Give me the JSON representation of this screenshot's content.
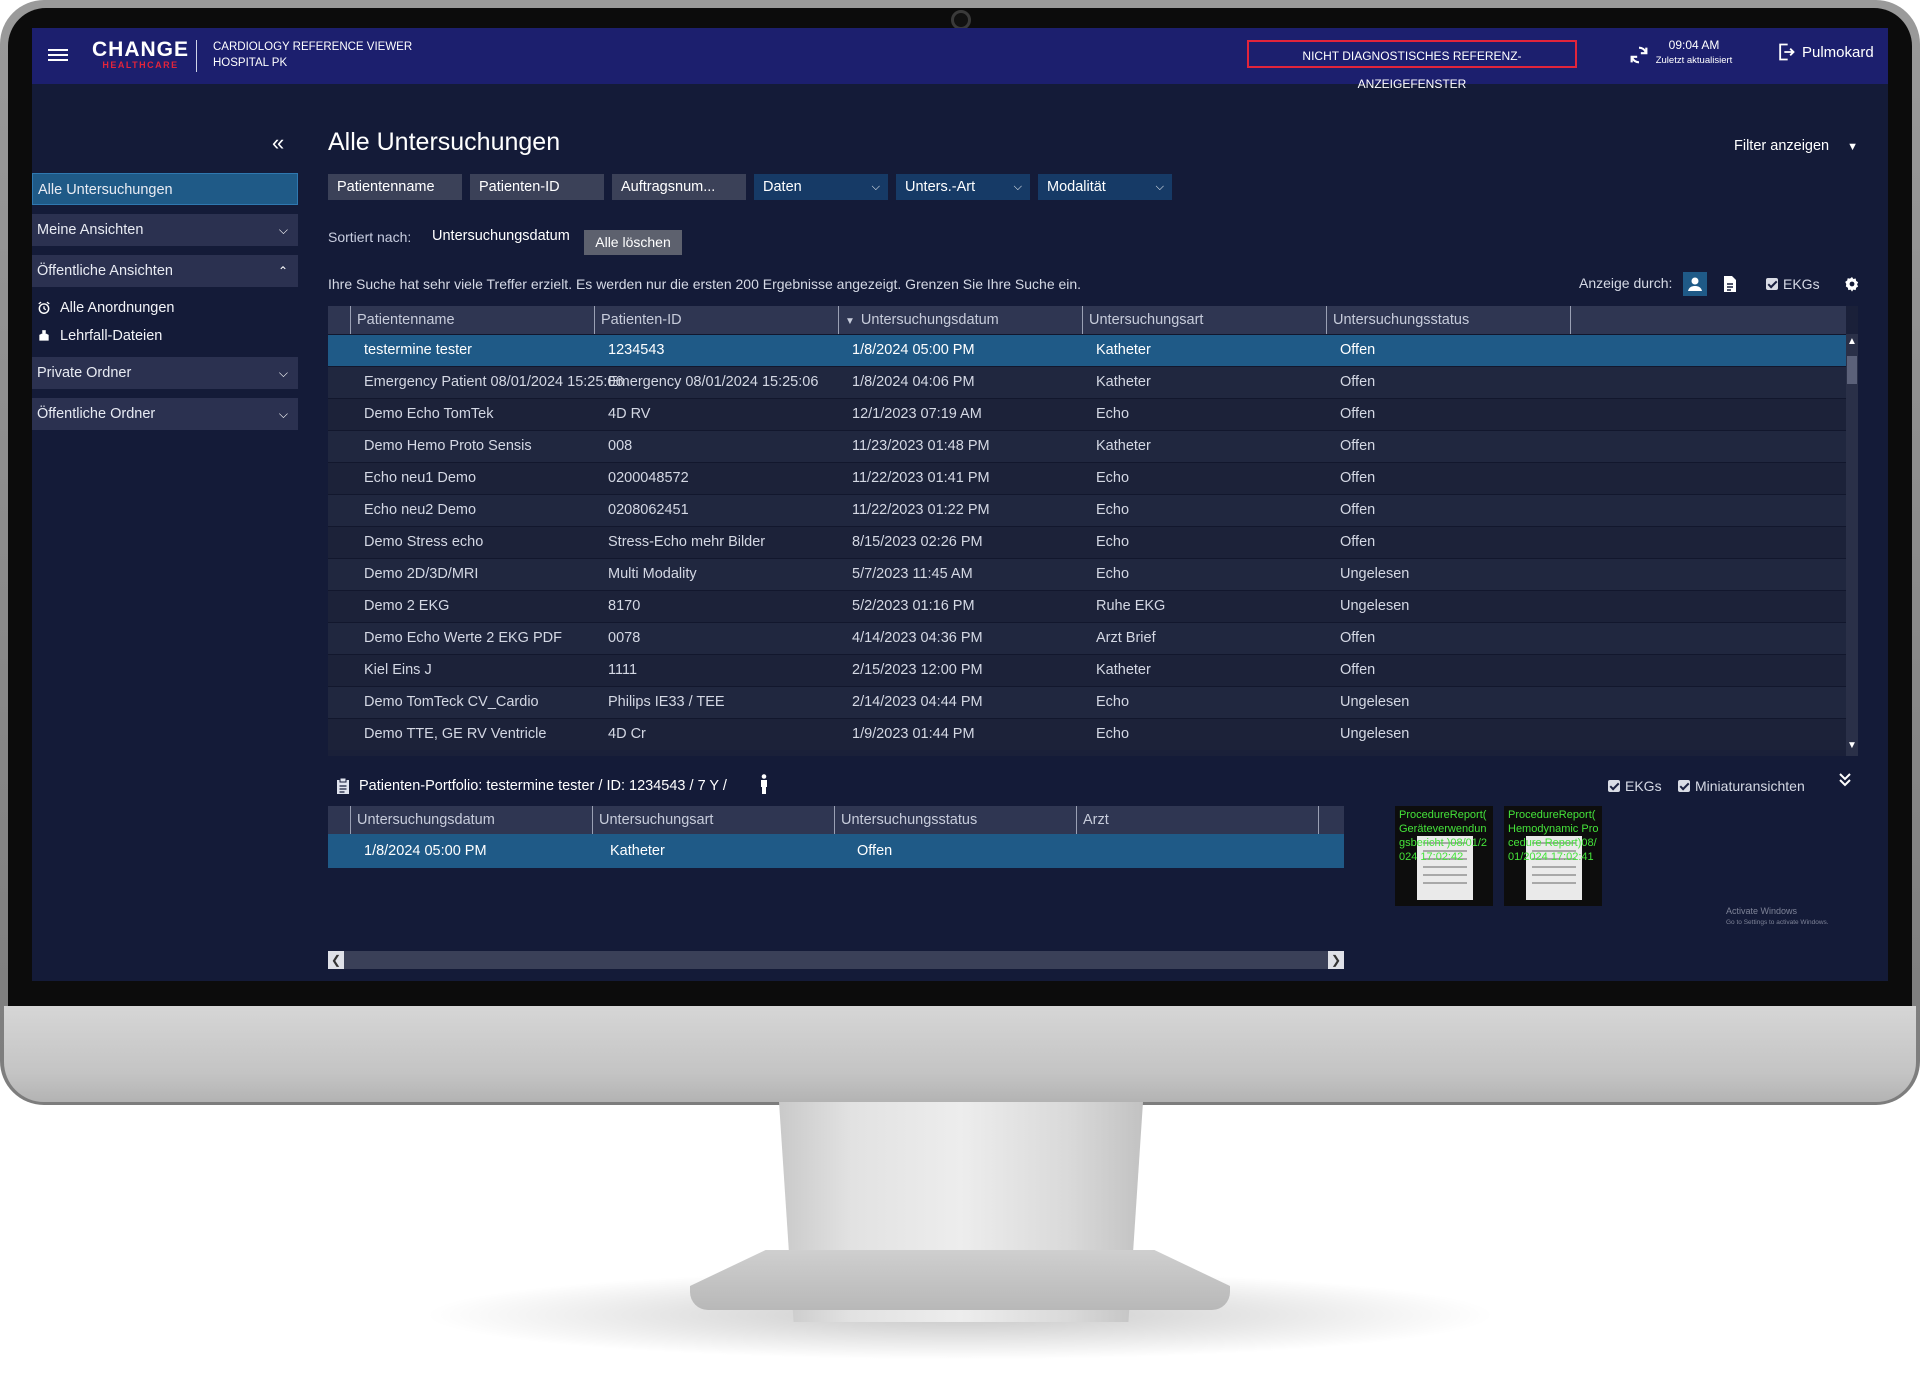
{
  "header": {
    "logo_top": "CHANGE",
    "logo_bottom": "HEALTHCARE",
    "app_title_line1": "CARDIOLOGY REFERENCE VIEWER",
    "app_title_line2": "HOSPITAL PK",
    "non_diagnostic_banner": "NICHT DIAGNOSTISCHES REFERENZ-ANZEIGEFENSTER",
    "time": "09:04 AM",
    "last_updated": "Zuletzt aktualisiert",
    "user": "Pulmokard"
  },
  "sidebar": {
    "items": [
      {
        "label": "Alle Untersuchungen"
      },
      {
        "label": "Meine Ansichten"
      },
      {
        "label": "Öffentliche Ansichten"
      },
      {
        "label": "Alle Anordnungen"
      },
      {
        "label": "Lehrfall-Dateien"
      },
      {
        "label": "Private Ordner"
      },
      {
        "label": "Öffentliche Ordner"
      }
    ]
  },
  "main": {
    "title": "Alle Untersuchungen",
    "filter_toggle": "Filter anzeigen",
    "filters": {
      "patient_name": "Patientenname",
      "patient_id": "Patienten-ID",
      "order_number": "Auftragsnum...",
      "dates": "Daten",
      "exam_type": "Unters.-Art",
      "modality": "Modalität"
    },
    "sorted_by_label": "Sortiert nach:",
    "sorted_by_value": "Untersuchungsdatum",
    "clear_all": "Alle löschen",
    "warning": "Ihre Suche hat sehr viele Treffer erzielt. Es werden nur die ersten 200 Ergebnisse angezeigt. Grenzen Sie Ihre Suche ein.",
    "display_by": "Anzeige durch:",
    "ekgs_label": "EKGs"
  },
  "table": {
    "columns": [
      "Patientenname",
      "Patienten-ID",
      "Untersuchungsdatum",
      "Untersuchungsart",
      "Untersuchungsstatus"
    ],
    "rows": [
      [
        "testermine tester",
        "1234543",
        "1/8/2024 05:00 PM",
        "Katheter",
        "Offen"
      ],
      [
        "Emergency Patient 08/01/2024 15:25:06",
        "Emergency 08/01/2024 15:25:06",
        "1/8/2024 04:06 PM",
        "Katheter",
        "Offen"
      ],
      [
        "Demo Echo TomTek",
        "4D RV",
        "12/1/2023 07:19 AM",
        "Echo",
        "Offen"
      ],
      [
        "Demo Hemo Proto Sensis",
        "008",
        "11/23/2023 01:48 PM",
        "Katheter",
        "Offen"
      ],
      [
        "Echo neu1 Demo",
        "0200048572",
        "11/22/2023 01:41 PM",
        "Echo",
        "Offen"
      ],
      [
        "Echo neu2 Demo",
        "0208062451",
        "11/22/2023 01:22 PM",
        "Echo",
        "Offen"
      ],
      [
        "Demo Stress echo",
        "Stress-Echo mehr Bilder",
        "8/15/2023 02:26 PM",
        "Echo",
        "Offen"
      ],
      [
        "Demo 2D/3D/MRI",
        "Multi Modality",
        "5/7/2023 11:45 AM",
        "Echo",
        "Ungelesen"
      ],
      [
        "Demo 2 EKG",
        "8170",
        "5/2/2023 01:16 PM",
        "Ruhe EKG",
        "Ungelesen"
      ],
      [
        "Demo Echo Werte 2 EKG PDF",
        "0078",
        "4/14/2023 04:36 PM",
        "Arzt Brief",
        "Offen"
      ],
      [
        "Kiel Eins J",
        "1111",
        "2/15/2023 12:00 PM",
        "Katheter",
        "Offen"
      ],
      [
        "Demo TomTeck CV_Cardio",
        "Philips IE33 / TEE",
        "2/14/2023 04:44 PM",
        "Echo",
        "Ungelesen"
      ],
      [
        "Demo TTE, GE RV Ventricle",
        "4D Cr",
        "1/9/2023 01:44 PM",
        "Echo",
        "Ungelesen"
      ]
    ]
  },
  "portfolio": {
    "label": "Patienten-Portfolio:",
    "name": "testermine tester",
    "id": "ID: 1234543",
    "age": "7 Y",
    "ekgs": "EKGs",
    "thumbnails_label": "Miniaturansichten",
    "columns": [
      "Untersuchungsdatum",
      "Untersuchungsart",
      "Untersuchungsstatus",
      "Arzt"
    ],
    "row": [
      "1/8/2024 05:00 PM",
      "Katheter",
      "Offen",
      ""
    ],
    "thumbnails": [
      {
        "caption": "ProcedureReport( Geräteverwendungsbericht )08/01/2024 17:02:42"
      },
      {
        "caption": "ProcedureReport( Hemodynamic Procedure Report)08/01/2024 17:02:41"
      }
    ]
  },
  "activate_windows": {
    "line1": "Activate Windows",
    "line2": "Go to Settings to activate Windows."
  }
}
